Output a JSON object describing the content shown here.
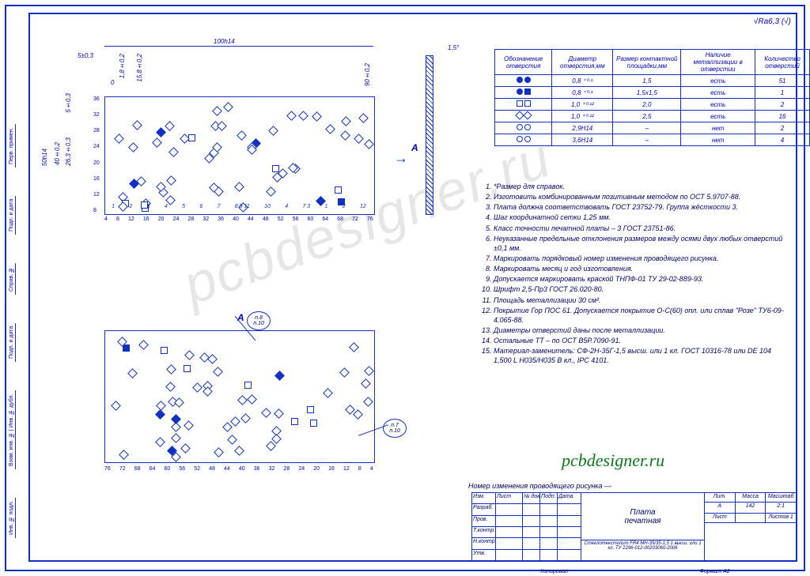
{
  "surface": "Ra6,3 (√)",
  "dimensions": {
    "w": "100h14",
    "h": "50h14",
    "a1": "5±0,3",
    "a2": "1,8±0,2",
    "a3": "15,8±0,2",
    "b1": "5±0,3",
    "b2": "26,3±0,3",
    "b3": "40±0,2",
    "v1": "90±0,2",
    "ang": "1,5°",
    "zero": "0"
  },
  "ruler_h": [
    "4",
    "8",
    "12",
    "16",
    "20",
    "24",
    "28",
    "32",
    "36",
    "40",
    "44",
    "48",
    "52",
    "56",
    "60",
    "64",
    "68",
    "72",
    "76"
  ],
  "ruler_h_rev": [
    "76",
    "72",
    "68",
    "64",
    "60",
    "56",
    "52",
    "48",
    "44",
    "40",
    "36",
    "32",
    "28",
    "24",
    "20",
    "16",
    "12",
    "8",
    "4"
  ],
  "ruler_v": [
    "8",
    "12",
    "16",
    "20",
    "24",
    "28",
    "32",
    "36"
  ],
  "comp_labels": [
    "1",
    "2",
    "3",
    "4",
    "5",
    "6",
    "7",
    "8 9 11",
    "10",
    "4",
    "7 3",
    "1",
    "2",
    "12"
  ],
  "section": "А",
  "hole_table": {
    "headers": [
      "Обозначение отверстия",
      "Диаметр отверстия,мм",
      "Размер контактной площадки,мм",
      "Наличие металлизации в отверстии",
      "Количество отверстий"
    ],
    "rows": [
      {
        "sym": "s1",
        "dia": "0,8 ⁺⁰·¹",
        "pad": "1,5",
        "met": "есть",
        "cnt": "51"
      },
      {
        "sym": "s2",
        "dia": "0,8 ⁺⁰·¹",
        "pad": "1,5х1,5",
        "met": "есть",
        "cnt": "1"
      },
      {
        "sym": "s3",
        "dia": "1,0 ⁺⁰·¹²",
        "pad": "2,0",
        "met": "есть",
        "cnt": "2"
      },
      {
        "sym": "s4",
        "dia": "1,0 ⁺⁰·¹²",
        "pad": "2,5",
        "met": "есть",
        "cnt": "16"
      },
      {
        "sym": "s5",
        "dia": "2,9H14",
        "pad": "–",
        "met": "нет",
        "cnt": "2"
      },
      {
        "sym": "s6",
        "dia": "3,6H14",
        "pad": "–",
        "met": "нет",
        "cnt": "4"
      }
    ]
  },
  "notes": [
    "*Размер для справок.",
    "Изготовить комбинированным позитивным методом по ОСТ 5.9707-88.",
    "Плата должна соответствовать ГОСТ 23752-79. Группа жёсткости 3.",
    "Шаг координатной сетки 1,25 мм.",
    "Класс точности печатной платы – 3 ГОСТ 23751-86.",
    "Неуказанные предельные отклонения размеров между осями двух любых отверстий ±0,1 мм.",
    "Маркировать порядковый номер изменения проводящего рисунка.",
    "Маркировать месяц и год изготовления.",
    "Допускается маркировать краской ТНПФ-01 ТУ 29-02-889-93.",
    "Шрифт 2,5-Пр3 ГОСТ 26.020-80.",
    "Площадь металлизации 30 см².",
    "Покрытие Гор ПОС 61. Допускается покрытие О-С(60) опл. или сплав \"Розе\" ТУ6-09-4.065-88.",
    "Диаметры отверстий даны после металлизации.",
    "Остальные ТТ – по ОСТ В5Р.7090-91.",
    "Материал-заменитель: СФ-2Н-35Г-1,5 высш. или 1 кл. ГОСТ 10316-78 или DE 104 1,500 L H035/H035 B кл., IPC 4101."
  ],
  "callouts": {
    "c1": "п.8\nп.10",
    "c2": "п.7\nп.10"
  },
  "rev_note": "Номер изменения проводящего рисунка —",
  "brand": "pcbdesigner.ru",
  "titleblock": {
    "left_rows": [
      [
        "Изм.",
        "Лист",
        "№ докум.",
        "Подп.",
        "Дата"
      ],
      [
        "Разраб.",
        "",
        "",
        "",
        ""
      ],
      [
        "Пров.",
        "",
        "",
        "",
        ""
      ],
      [
        "Т.контр.",
        "",
        "",
        "",
        ""
      ],
      [
        "Н.контр.",
        "",
        "",
        "",
        ""
      ],
      [
        "Утв.",
        "",
        "",
        "",
        ""
      ]
    ],
    "title": "Плата\nпечатная",
    "material": "Стеклотекстолит FR4 MH-35/35-1,5 1 высш. или 1 кл. ТУ 2296-012-00203060-2006",
    "lit_row": [
      "Лит.",
      "Масса",
      "Масштаб"
    ],
    "vals": [
      "А",
      "142",
      "2:1"
    ],
    "sheet_row": [
      "Лист",
      "",
      "Листов  1"
    ]
  },
  "stampline": [
    "Копировал",
    "Формат   А2"
  ],
  "side_tabs": [
    "Инв. № подл.",
    "Взам. инв. № | Инв. № дубл.",
    "Подп. и дата",
    "Справ. №",
    "Подп. и дата",
    "Перв. примен."
  ]
}
